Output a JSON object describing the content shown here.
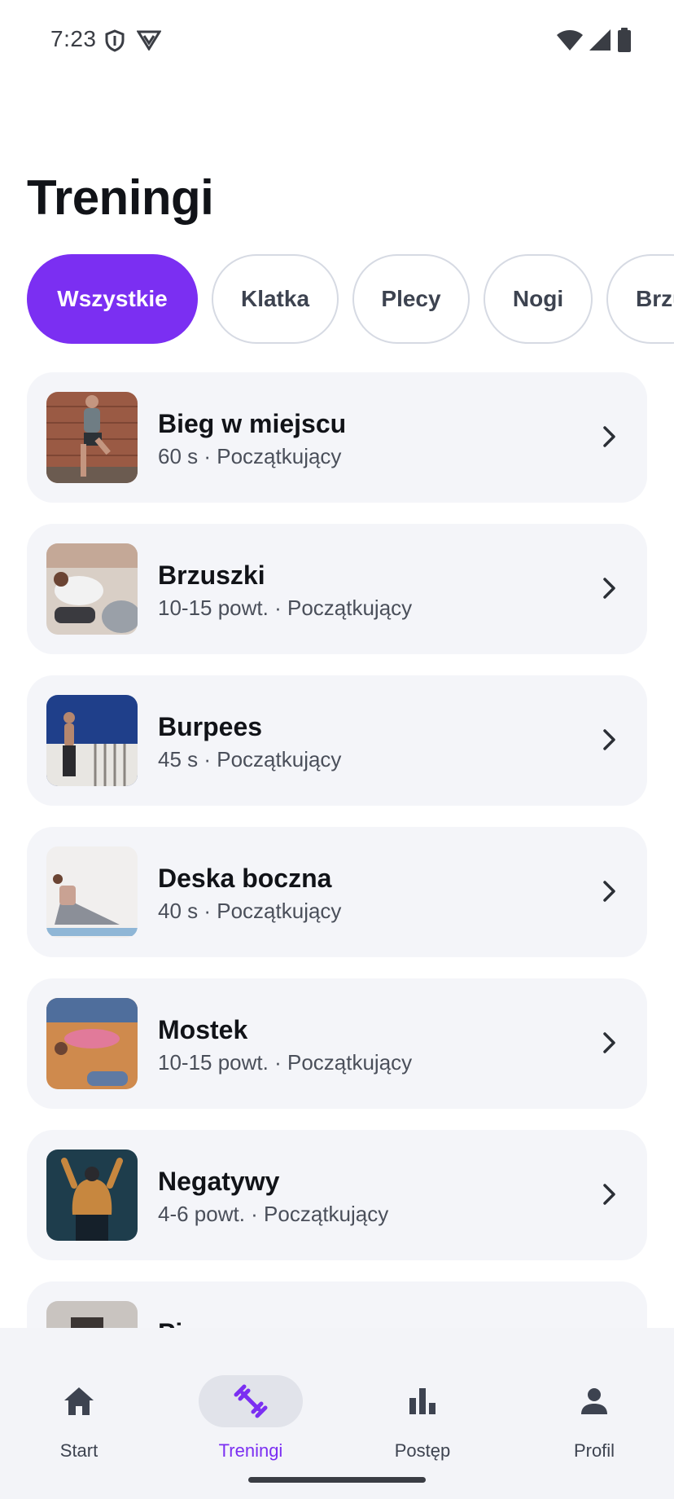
{
  "status_bar": {
    "time": "7:23",
    "left_icons": [
      "shield-icon",
      "vpn-icon"
    ],
    "right_icons": [
      "wifi-icon",
      "signal-icon",
      "battery-icon"
    ]
  },
  "page": {
    "title": "Treningi"
  },
  "filters": [
    {
      "label": "Wszystkie",
      "selected": true
    },
    {
      "label": "Klatka",
      "selected": false
    },
    {
      "label": "Plecy",
      "selected": false
    },
    {
      "label": "Nogi",
      "selected": false
    },
    {
      "label": "Brzu",
      "selected": false
    }
  ],
  "workouts": [
    {
      "title": "Bieg w miejscu",
      "subtitle": "60 s · Początkujący",
      "thumbnail": "running-in-place-photo"
    },
    {
      "title": "Brzuszki",
      "subtitle": "10-15 powt. · Początkujący",
      "thumbnail": "crunches-photo"
    },
    {
      "title": "Burpees",
      "subtitle": "45 s · Początkujący",
      "thumbnail": "burpees-photo"
    },
    {
      "title": "Deska boczna",
      "subtitle": "40 s · Początkujący",
      "thumbnail": "side-plank-photo"
    },
    {
      "title": "Mostek",
      "subtitle": "10-15 powt. · Początkujący",
      "thumbnail": "bridge-photo"
    },
    {
      "title": "Negatywy",
      "subtitle": "4-6 powt. · Początkujący",
      "thumbnail": "negatives-photo"
    },
    {
      "title": "Pi",
      "subtitle": "",
      "thumbnail": "next-exercise-photo"
    }
  ],
  "bottom_nav": [
    {
      "label": "Start",
      "icon": "home-icon",
      "active": false
    },
    {
      "label": "Treningi",
      "icon": "dumbbell-icon",
      "active": true
    },
    {
      "label": "Postęp",
      "icon": "bar-chart-icon",
      "active": false
    },
    {
      "label": "Profil",
      "icon": "person-icon",
      "active": false
    }
  ],
  "colors": {
    "accent": "#7b2ff2",
    "card_background": "#f4f5f9",
    "nav_background": "#f3f4f8",
    "chip_border": "#d6dae3"
  }
}
